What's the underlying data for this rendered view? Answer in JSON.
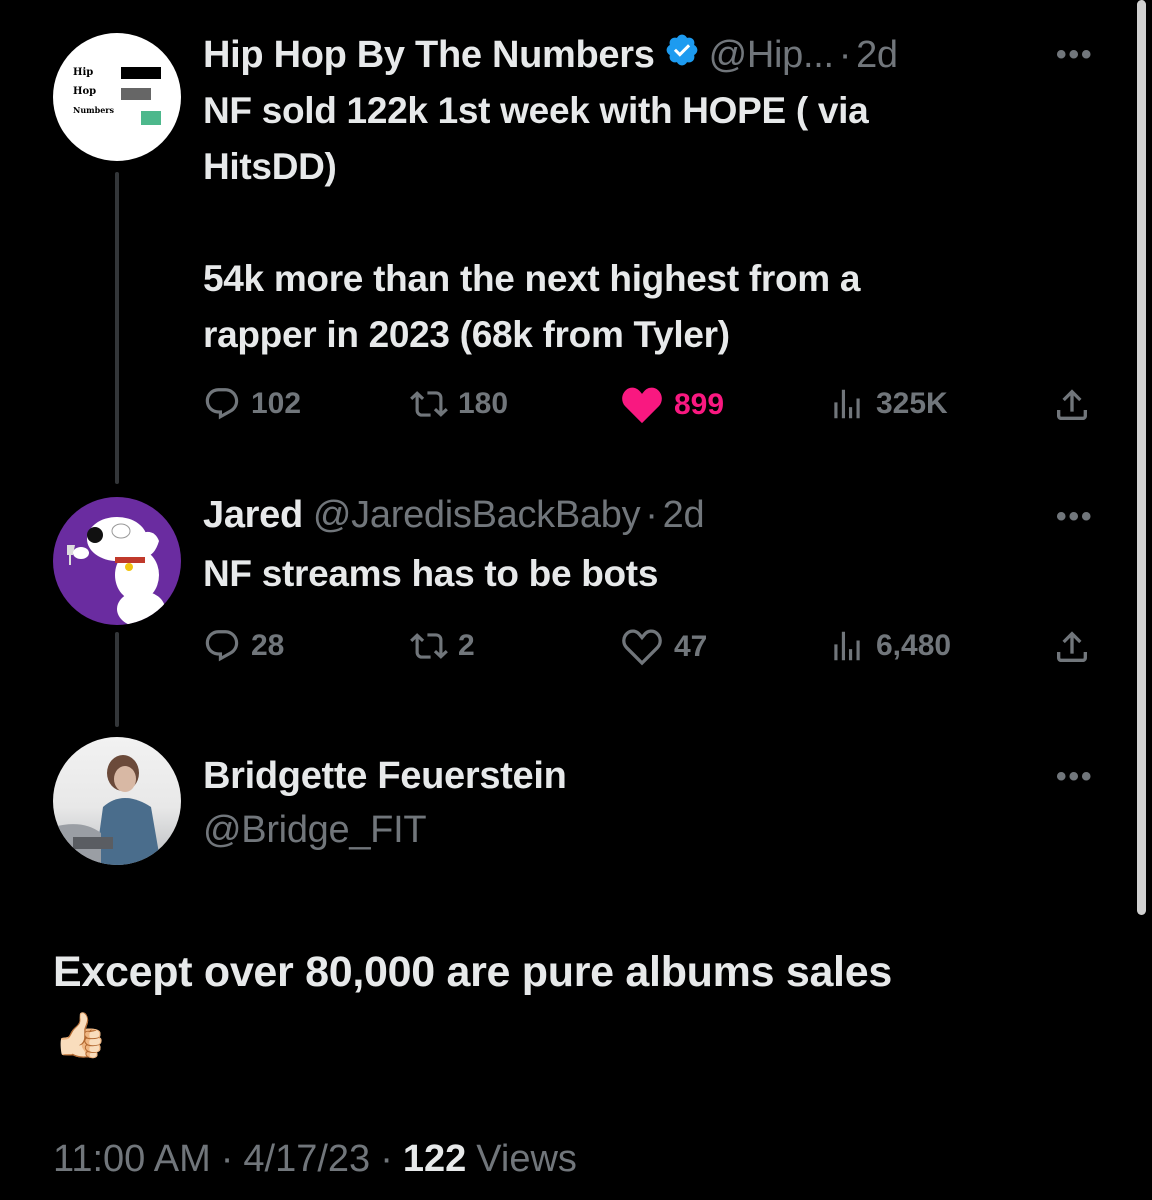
{
  "tweets": [
    {
      "avatar_lines": [
        "Hip",
        "Hop",
        "Numbers"
      ],
      "display_name": "Hip Hop By The Numbers",
      "handle": "@Hip...",
      "separator": "·",
      "time": "2d",
      "verified": true,
      "text_lines": [
        "NF sold 122k 1st week with HOPE ( via",
        "HitsDD)",
        "",
        "54k more than the next highest from a",
        "rapper in 2023 (68k from Tyler)"
      ],
      "replies": "102",
      "retweets": "180",
      "likes": "899",
      "liked": true,
      "views": "325K",
      "more_icon": "ellipsis-icon"
    },
    {
      "display_name": "Jared",
      "handle": "@JaredisBackBaby",
      "separator": "·",
      "time": "2d",
      "text_lines": [
        "NF streams has to be bots"
      ],
      "replies": "28",
      "retweets": "2",
      "likes": "47",
      "liked": false,
      "views": "6,480",
      "more_icon": "ellipsis-icon"
    }
  ],
  "main_tweet": {
    "display_name": "Bridgette Feuerstein",
    "handle": "@Bridge_FIT",
    "text": "Except over 80,000 are pure albums sales",
    "emoji": "👍🏻",
    "time": "11:00 AM",
    "sep1": "·",
    "date": "4/17/23",
    "sep2": "·",
    "views_count": "122",
    "views_label": "Views"
  },
  "colors": {
    "background": "#000000",
    "text": "#e7e9ea",
    "muted": "#71767b",
    "like_active": "#f91880",
    "verified": "#1d9bf0",
    "avatar_purple": "#6a2ca0"
  }
}
